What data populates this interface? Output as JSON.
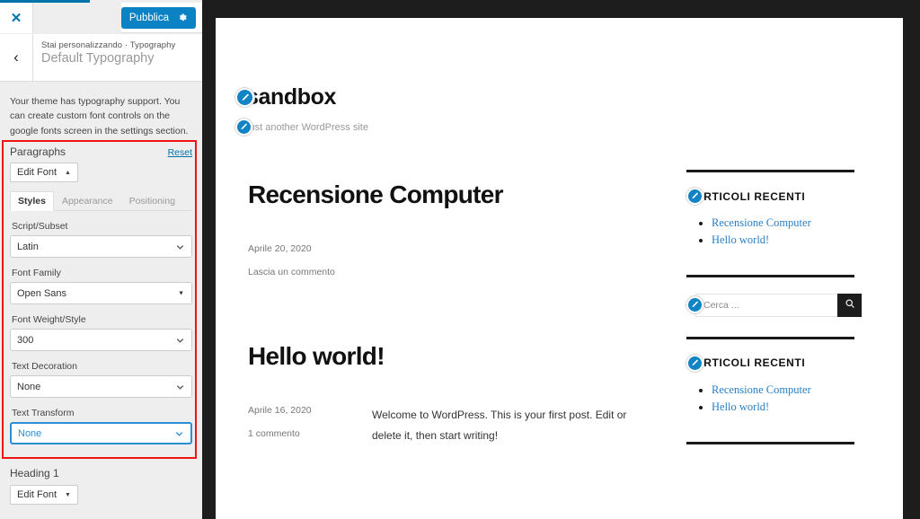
{
  "colors": {
    "accent_blue": "#0b82c4",
    "wp_blue": "#0073aa",
    "annotation_red": "#f01414",
    "dark_chrome": "#1d1d1d",
    "link_blue": "#2a7fc4"
  },
  "panel": {
    "close_label": "✕",
    "publish_label": "Pubblica",
    "gear_icon": "gear-icon",
    "back_label": "‹",
    "breadcrumb": "Stai personalizzando · Typography",
    "section_title": "Default Typography",
    "description": "Your theme has typography support. You can create custom font controls on the google fonts screen in the settings section.",
    "paragraphs": {
      "label": "Paragraphs",
      "reset_label": "Reset",
      "edit_font_label": "Edit Font",
      "edit_font_caret": "▲",
      "tabs": [
        {
          "label": "Styles",
          "active": true
        },
        {
          "label": "Appearance",
          "active": false
        },
        {
          "label": "Positioning",
          "active": false
        }
      ],
      "fields": [
        {
          "label": "Script/Subset",
          "value": "Latin",
          "style": "chevron",
          "focused": false
        },
        {
          "label": "Font Family",
          "value": "Open Sans",
          "style": "triangle",
          "focused": false
        },
        {
          "label": "Font Weight/Style",
          "value": "300",
          "style": "chevron",
          "focused": false
        },
        {
          "label": "Text Decoration",
          "value": "None",
          "style": "chevron",
          "focused": false
        },
        {
          "label": "Text Transform",
          "value": "None",
          "style": "chevron",
          "focused": true
        }
      ]
    },
    "heading1": {
      "label": "Heading 1",
      "edit_font_label": "Edit Font",
      "edit_font_caret": "▼"
    }
  },
  "preview": {
    "site_title": "sandbox",
    "site_tagline": "Just another WordPress site",
    "edit_icon": "pencil-icon",
    "posts": [
      {
        "title": "Recensione Computer",
        "date": "Aprile 20, 2020",
        "comments": "Lascia un commento",
        "excerpt": ""
      },
      {
        "title": "Hello world!",
        "date": "Aprile 16, 2020",
        "comments": "1 commento",
        "excerpt": "Welcome to WordPress. This is your first post. Edit or delete it, then start writing!"
      }
    ],
    "widgets": {
      "recent_posts_1": {
        "title": "ARTICOLI RECENTI",
        "links": [
          "Recensione Computer",
          "Hello world!"
        ]
      },
      "search": {
        "placeholder": "Cerca ...",
        "value": "",
        "button_icon": "search-icon"
      },
      "recent_posts_2": {
        "title": "ARTICOLI RECENTI",
        "links": [
          "Recensione Computer",
          "Hello world!"
        ]
      }
    }
  }
}
